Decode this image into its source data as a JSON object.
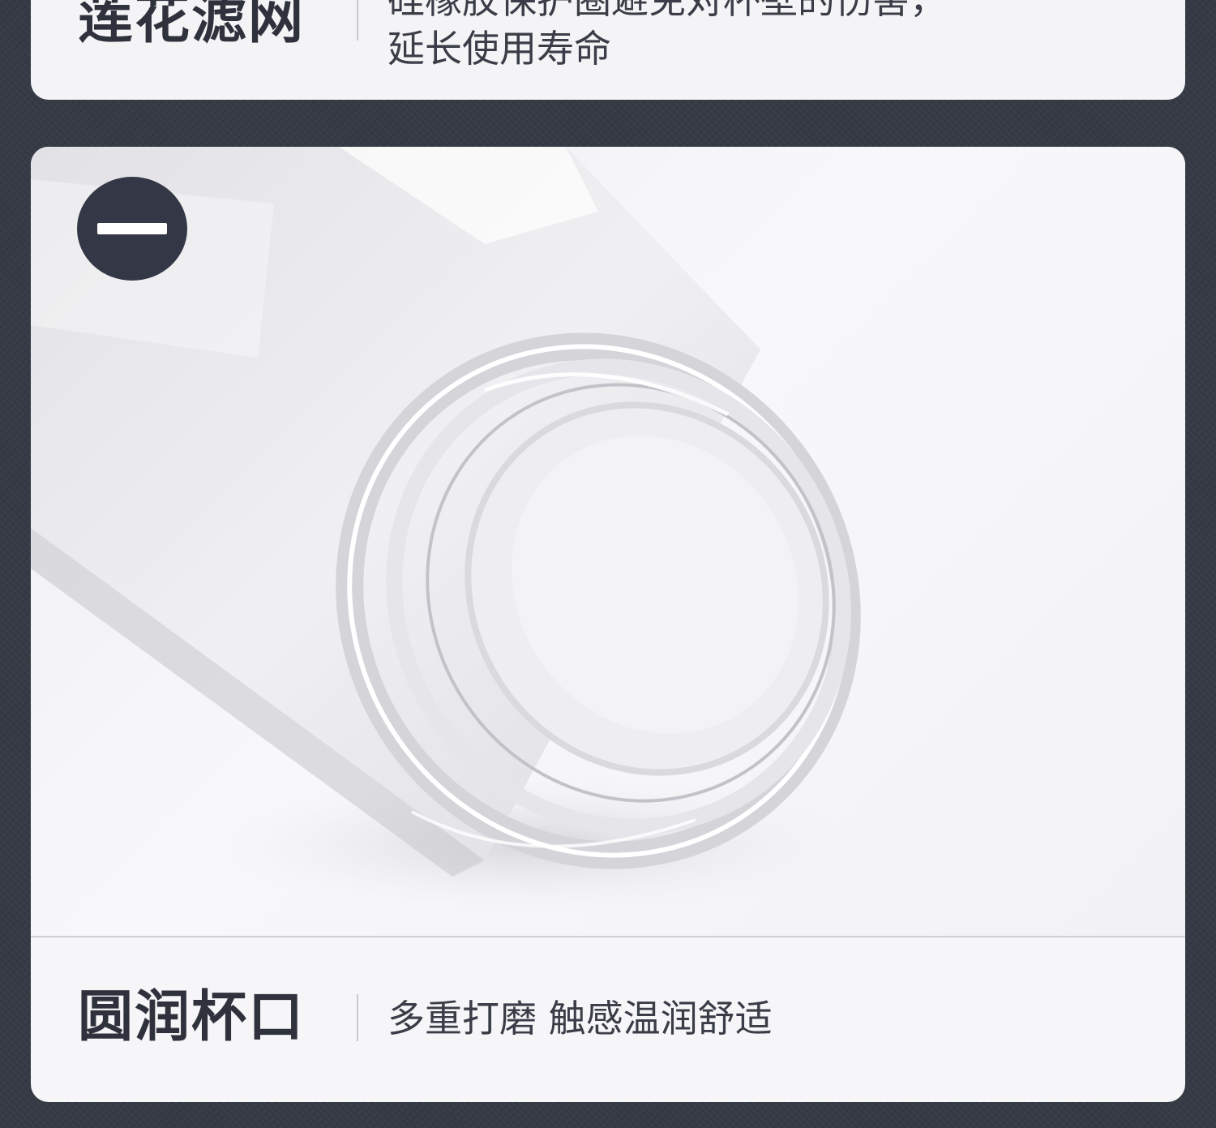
{
  "sections": [
    {
      "title": "莲花滤网",
      "description_lines": [
        "硅橡胶保护圈避免对杯壁的伤害，",
        "延长使用寿命"
      ]
    },
    {
      "title": "圆润杯口",
      "description": "多重打磨 触感温润舒适"
    }
  ],
  "badge": {
    "icon": "minus-icon",
    "color": "#343846"
  },
  "colors": {
    "background": "#363a45",
    "card": "#f4f4f6",
    "text": "#2f323c"
  }
}
